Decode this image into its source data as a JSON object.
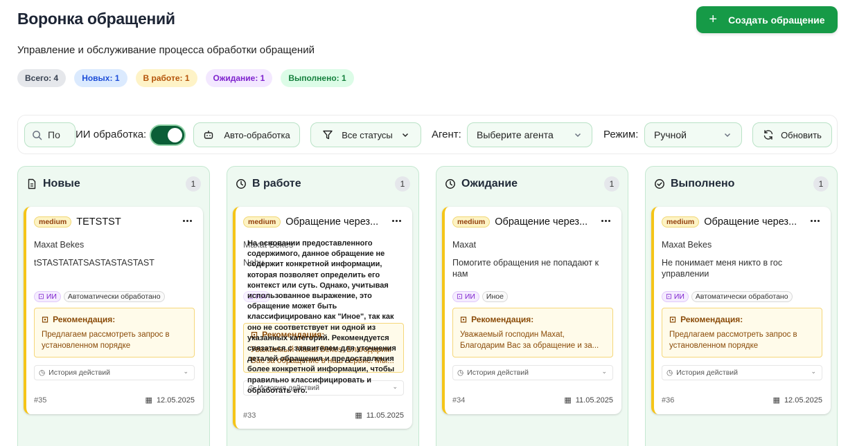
{
  "header": {
    "title": "Воронка обращений",
    "subtitle": "Управление и обслуживание процесса обработки обращений",
    "create_label": "Создать обращение"
  },
  "counters": {
    "all": "Всего: 4",
    "new": "Новых: 1",
    "work": "В работе: 1",
    "wait": "Ожидание: 1",
    "done": "Выполнено: 1"
  },
  "toolbar": {
    "search_value": "По",
    "ai_label": "ИИ обработка:",
    "ai_enabled": true,
    "auto_label": "Авто-обработка",
    "status_value": "Все статусы",
    "agent_label": "Агент:",
    "agent_placeholder": "Выберите агента",
    "mode_label": "Режим:",
    "mode_value": "Ручной",
    "refresh_label": "Обновить"
  },
  "columns": [
    {
      "title": "Новые",
      "count": "1",
      "card": {
        "priority": "medium",
        "title": "TETSTST",
        "author": "Maxat Bekes",
        "description": "tSTASTATATSASTASTASTAST",
        "ai_tag": "ИИ",
        "category": "Автоматически обработано",
        "reco_title": "Рекомендация:",
        "reco_text": "Предлагаем рассмотреть запрос в установленном порядке",
        "history": "История действий",
        "id": "#35",
        "date": "12.05.2025"
      }
    },
    {
      "title": "В работе",
      "count": "1",
      "card": {
        "priority": "medium",
        "title": "Обращение через...",
        "author": "Maxat Bekes",
        "description": "Nahu",
        "overlay": "На основании предоставленного содержимого, данное обращение не содержит конкретной информации, которая позволяет определить его контекст или суть. Однако, учитывая использованное выражение, это обращение может быть классифицировано как \"Иное\", так как оно не соответствует ни одной из указанных категорий. Рекомендуется связаться с заявителем для уточнения деталей обращения и предоставления более конкретной информации, чтобы правильно классифицировать и обработать его.",
        "ai_tag": "ИИ",
        "reco_title": "Рекомендация:",
        "reco_text": "Уважаемый Maxat Bekes, Благодарим Вас за обращение в наш сервис. Мы...",
        "history": "История действий",
        "id": "#33",
        "date": "11.05.2025"
      }
    },
    {
      "title": "Ожидание",
      "count": "1",
      "card": {
        "priority": "medium",
        "title": "Обращение через...",
        "author": "Maxat",
        "description": "Помогите обращения не попадают к нам",
        "ai_tag": "ИИ",
        "category": "Иное",
        "reco_title": "Рекомендация:",
        "reco_text": "Уважаемый господин Maxat, Благодарим Вас за обращение и за...",
        "history": "История действий",
        "id": "#34",
        "date": "11.05.2025"
      }
    },
    {
      "title": "Выполнено",
      "count": "1",
      "card": {
        "priority": "medium",
        "title": "Обращение через...",
        "author": "Maxat Bekes",
        "description": "Не понимает меня никто в гос управлении",
        "ai_tag": "ИИ",
        "category": "Автоматически обработано",
        "reco_title": "Рекомендация:",
        "reco_text": "Предлагаем рассмотреть запрос в установленном порядке",
        "history": "История действий",
        "id": "#36",
        "date": "12.05.2025"
      }
    }
  ],
  "colors": {
    "primary": "#169a47",
    "toggle": "#0b5e37",
    "card_accent": "#f5c518"
  }
}
